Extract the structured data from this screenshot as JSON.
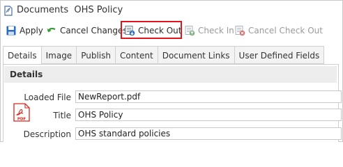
{
  "window": {
    "title": "Documents  OHS Policy"
  },
  "toolbar": {
    "apply": "Apply",
    "cancel_changes": "Cancel Changes",
    "check_out": "Check Out",
    "check_in": "Check In",
    "cancel_check_out": "Cancel Check Out"
  },
  "tabs": [
    "Details",
    "Image",
    "Publish",
    "Content",
    "Document Links",
    "User Defined Fields"
  ],
  "section": {
    "title": "Details"
  },
  "fields": {
    "loaded_file": {
      "label": "Loaded File",
      "value": "NewReport.pdf"
    },
    "title": {
      "label": "Title",
      "value": "OHS Policy"
    },
    "description": {
      "label": "Description",
      "value": "OHS standard policies"
    }
  },
  "file_icon": {
    "label": "PDF"
  },
  "colors": {
    "highlight": "#e0141a",
    "accent_blue": "#2a6cc4",
    "pdf_red": "#d9251d"
  },
  "icons": [
    "document-icon",
    "save-icon",
    "undo-icon",
    "check-out-icon",
    "check-in-icon",
    "cancel-check-out-icon",
    "pdf-icon"
  ]
}
